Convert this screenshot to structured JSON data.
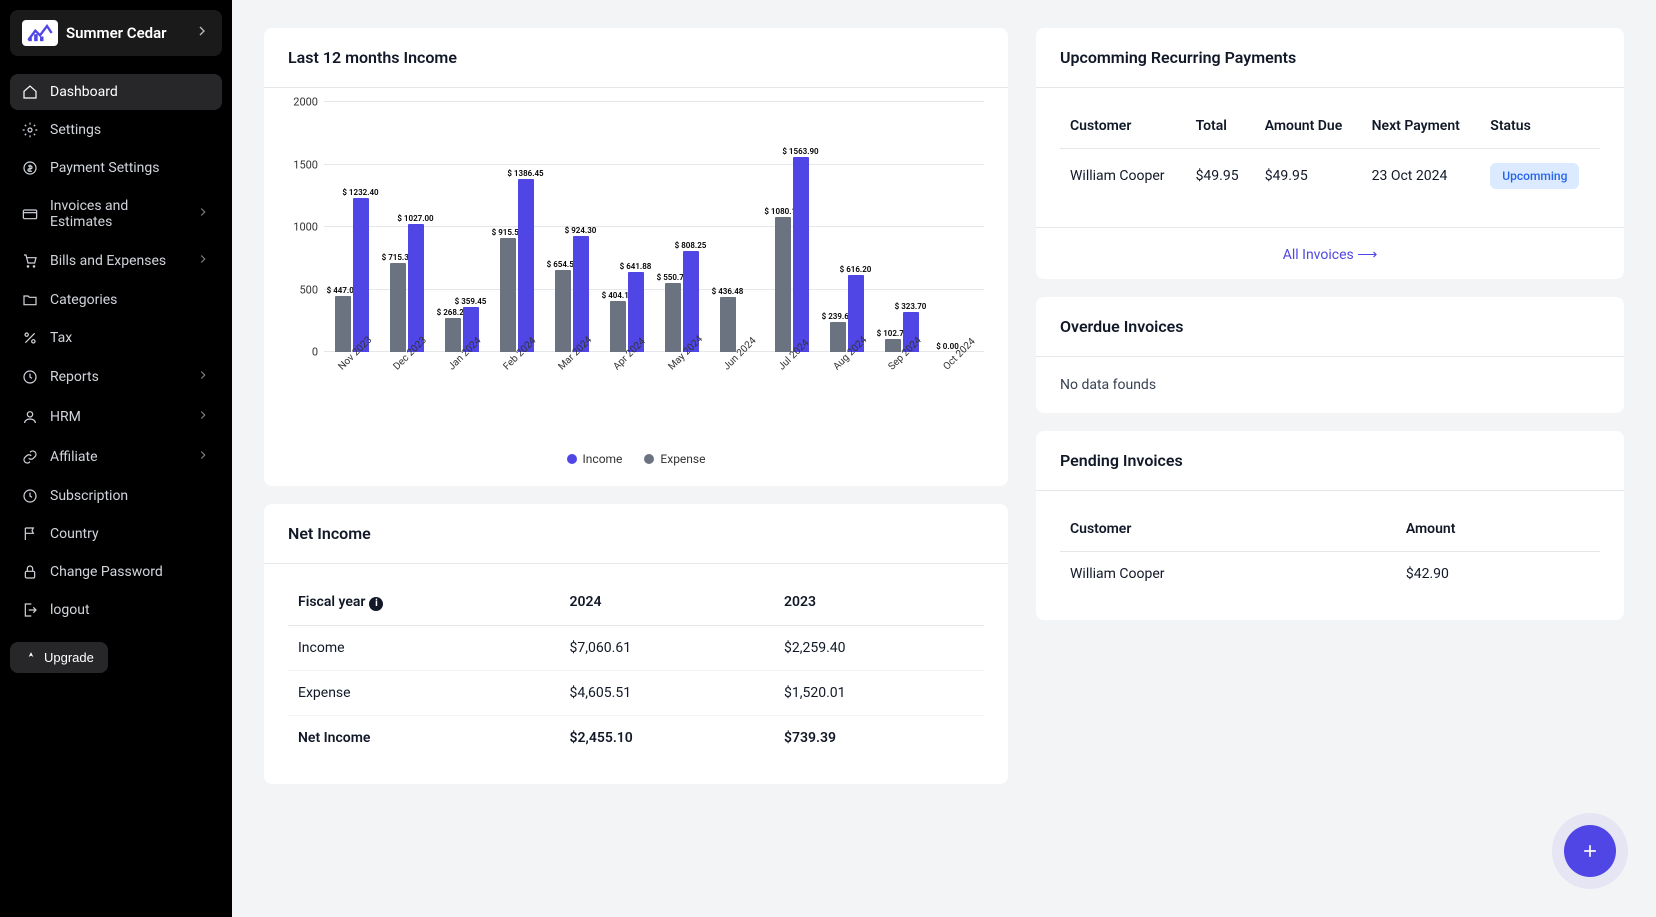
{
  "company": {
    "name": "Summer Cedar"
  },
  "sidebar": {
    "items": [
      {
        "label": "Dashboard",
        "icon": "home",
        "active": true
      },
      {
        "label": "Settings",
        "icon": "gear"
      },
      {
        "label": "Payment Settings",
        "icon": "dollar"
      },
      {
        "label": "Invoices and Estimates",
        "icon": "card",
        "expandable": true
      },
      {
        "label": "Bills and Expenses",
        "icon": "cart",
        "expandable": true
      },
      {
        "label": "Categories",
        "icon": "folder"
      },
      {
        "label": "Tax",
        "icon": "percent"
      },
      {
        "label": "Reports",
        "icon": "clock",
        "expandable": true
      },
      {
        "label": "HRM",
        "icon": "user",
        "expandable": true
      },
      {
        "label": "Affiliate",
        "icon": "link",
        "expandable": true
      },
      {
        "label": "Subscription",
        "icon": "clock2"
      },
      {
        "label": "Country",
        "icon": "flag"
      },
      {
        "label": "Change Password",
        "icon": "lock"
      },
      {
        "label": "logout",
        "icon": "logout"
      }
    ],
    "upgrade": "Upgrade"
  },
  "chart_card": {
    "title": "Last 12 months Income"
  },
  "chart_data": {
    "type": "bar",
    "title": "Last 12 months Income",
    "xlabel": "",
    "ylabel": "",
    "ylim": [
      0,
      2000
    ],
    "yticks": [
      0,
      500,
      1000,
      1500,
      2000
    ],
    "categories": [
      "Nov 2023",
      "Dec 2023",
      "Jan 2024",
      "Feb 2024",
      "Mar 2024",
      "Apr 2024",
      "May 2024",
      "Jun 2024",
      "Jul 2024",
      "Aug 2024",
      "Sep 2024",
      "Oct 2024"
    ],
    "series": [
      {
        "name": "Expense",
        "color": "#6b7280",
        "values": [
          447.06,
          715.3,
          268.24,
          915.58,
          654.5,
          404.14,
          550.78,
          436.48,
          1080.1,
          239.63,
          102.7,
          0.0
        ]
      },
      {
        "name": "Income",
        "color": "#4f46e5",
        "values": [
          1232.4,
          1027.0,
          359.45,
          1386.45,
          924.3,
          641.88,
          808.25,
          null,
          1563.9,
          616.2,
          323.7,
          null
        ]
      }
    ],
    "legend": [
      "Income",
      "Expense"
    ]
  },
  "net_income": {
    "title": "Net Income",
    "fiscal_label": "Fiscal year",
    "years": [
      "2024",
      "2023"
    ],
    "rows": [
      {
        "label": "Income",
        "vals": [
          "$7,060.61",
          "$2,259.40"
        ]
      },
      {
        "label": "Expense",
        "vals": [
          "$4,605.51",
          "$1,520.01"
        ]
      },
      {
        "label": "Net Income",
        "vals": [
          "$2,455.10",
          "$739.39"
        ]
      }
    ]
  },
  "recurring": {
    "title": "Upcomming Recurring Payments",
    "headers": [
      "Customer",
      "Total",
      "Amount Due",
      "Next Payment",
      "Status"
    ],
    "rows": [
      {
        "customer": "William Cooper",
        "total": "$49.95",
        "due": "$49.95",
        "next": "23 Oct 2024",
        "status": "Upcomming"
      }
    ],
    "all_link": "All Invoices ⟶"
  },
  "overdue": {
    "title": "Overdue Invoices",
    "empty": "No data founds"
  },
  "pending": {
    "title": "Pending Invoices",
    "headers": [
      "Customer",
      "Amount"
    ],
    "rows": [
      {
        "customer": "William Cooper",
        "amount": "$42.90"
      }
    ]
  }
}
